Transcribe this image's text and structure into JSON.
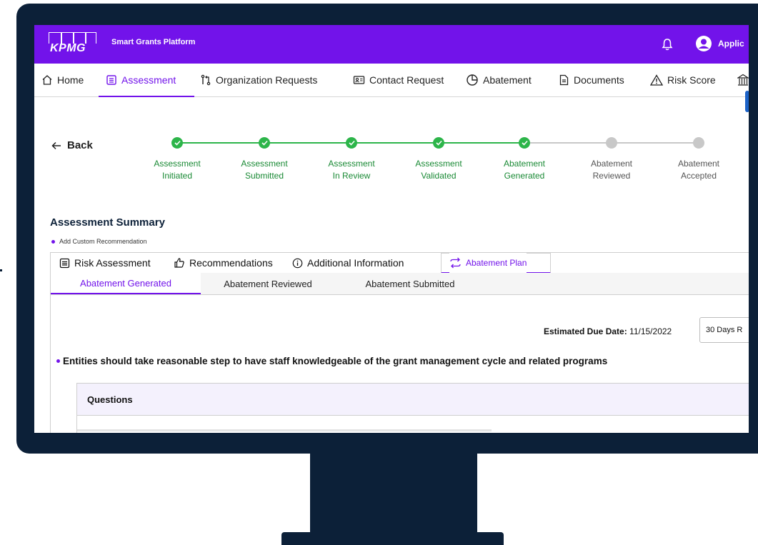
{
  "app": {
    "logo_text": "KPMG",
    "title": "Smart Grants Platform",
    "user_label": "Applic"
  },
  "nav": {
    "items": [
      {
        "label": "Home",
        "icon": "home-icon"
      },
      {
        "label": "Assessment",
        "icon": "document-list-icon",
        "active": true
      },
      {
        "label": "Organization Requests",
        "icon": "git-pull-icon"
      },
      {
        "label": "Contact Request",
        "icon": "contact-card-icon"
      },
      {
        "label": "Abatement",
        "icon": "pie-chart-icon"
      },
      {
        "label": "Documents",
        "icon": "document-icon"
      },
      {
        "label": "Risk Score",
        "icon": "warning-icon"
      }
    ]
  },
  "back_label": "Back",
  "stepper": {
    "steps": [
      {
        "line1": "Assessment",
        "line2": "Initiated",
        "done": true
      },
      {
        "line1": "Assessment",
        "line2": "Submitted",
        "done": true
      },
      {
        "line1": "Assessment",
        "line2": "In Review",
        "done": true
      },
      {
        "line1": "Assessment",
        "line2": "Validated",
        "done": true
      },
      {
        "line1": "Abatement",
        "line2": "Generated",
        "done": true
      },
      {
        "line1": "Abatement",
        "line2": "Reviewed",
        "done": false
      },
      {
        "line1": "Abatement",
        "line2": "Accepted",
        "done": false
      }
    ]
  },
  "summary": {
    "title": "Assessment Summary",
    "add_custom": "Add Custom Recommendation"
  },
  "tabs": {
    "primary": [
      {
        "label": "Risk Assessment",
        "icon": "list-icon"
      },
      {
        "label": "Recommendations",
        "icon": "thumbs-up-icon"
      },
      {
        "label": "Additional Information",
        "icon": "info-icon"
      },
      {
        "label": "Abatement Plan",
        "icon": "sync-icon",
        "active": true
      }
    ],
    "secondary": [
      {
        "label": "Abatement Generated",
        "active": true
      },
      {
        "label": "Abatement Reviewed"
      },
      {
        "label": "Abatement Submitted"
      }
    ]
  },
  "due": {
    "label": "Estimated Due Date:",
    "value": "11/15/2022",
    "select_value": "30 Days R"
  },
  "entity_text": "Entities should take reasonable step to have staff knowledgeable of the grant management cycle and related programs",
  "questions_header": "Questions",
  "colors": {
    "brand": "#7213ea",
    "frame": "#0c2038",
    "success": "#2db54a",
    "pending": "#c8c8c8"
  }
}
